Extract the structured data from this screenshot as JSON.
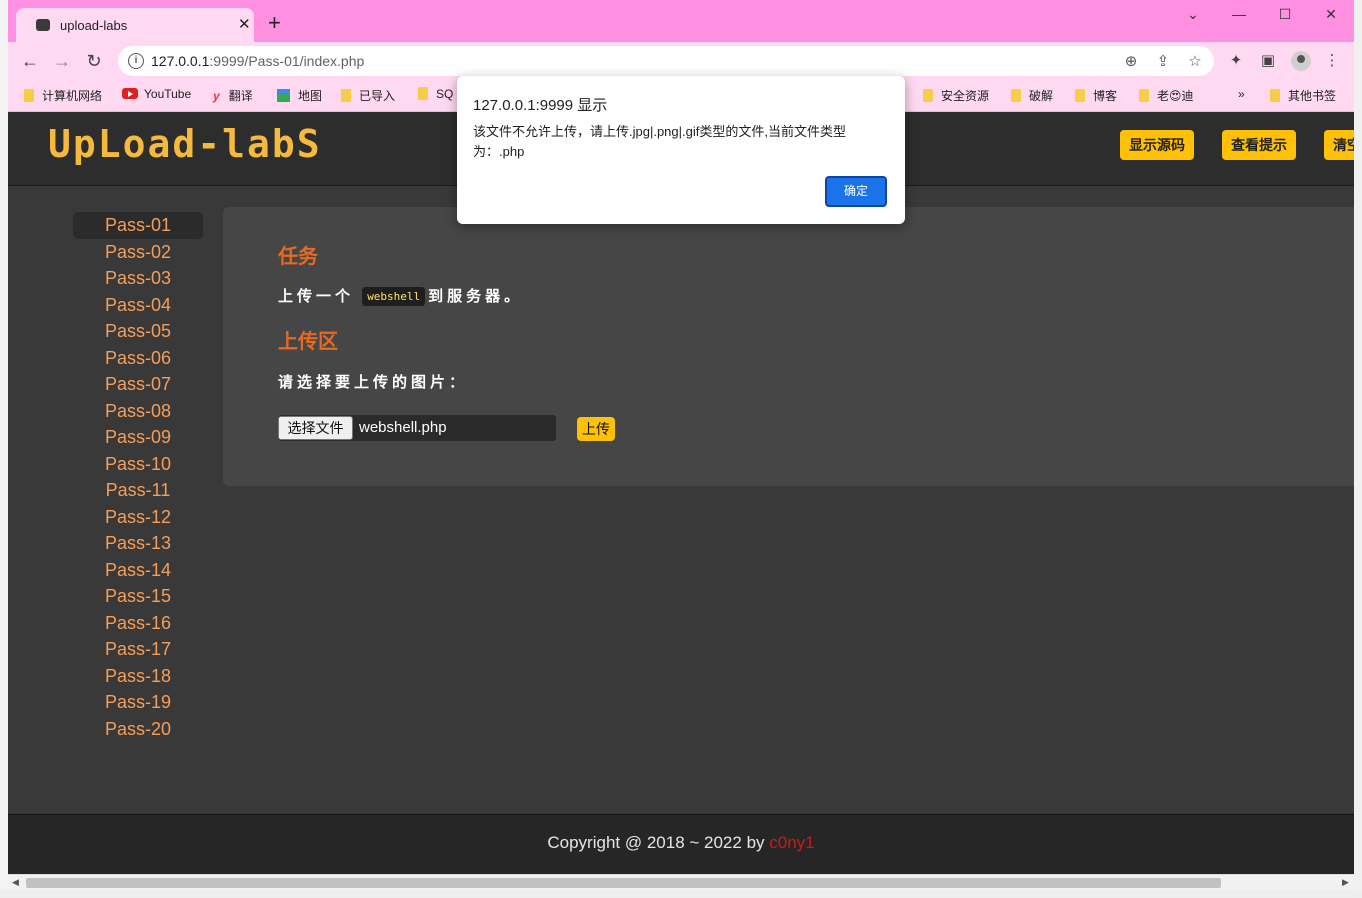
{
  "browser": {
    "tab_title": "upload-labs",
    "new_tab": "+",
    "url_host": "127.0.0.1",
    "url_rest": ":9999/Pass-01/index.php",
    "bookmarks": [
      "计算机网络",
      "YouTube",
      "翻译",
      "地图",
      "已导入",
      "SQ",
      "安全资源",
      "破解",
      "博客",
      "老😍迪",
      "»",
      "其他书签"
    ]
  },
  "header": {
    "logo": "UpLoad-labS",
    "buttons": [
      "显示源码",
      "查看提示",
      "清空"
    ]
  },
  "sidebar": {
    "items": [
      "Pass-01",
      "Pass-02",
      "Pass-03",
      "Pass-04",
      "Pass-05",
      "Pass-06",
      "Pass-07",
      "Pass-08",
      "Pass-09",
      "Pass-10",
      "Pass-11",
      "Pass-12",
      "Pass-13",
      "Pass-14",
      "Pass-15",
      "Pass-16",
      "Pass-17",
      "Pass-18",
      "Pass-19",
      "Pass-20"
    ],
    "active": "Pass-01"
  },
  "main": {
    "task_heading": "任务",
    "task_prefix": "上传一个",
    "task_code": "webshell",
    "task_suffix": "到服务器。",
    "upload_heading": "上传区",
    "upload_prompt": "请选择要上传的图片：",
    "file_button": "选择文件",
    "file_name": "webshell.php",
    "upload_button": "上传"
  },
  "footer": {
    "copyright": "Copyright @ 2018 ~ 2022 by ",
    "author": "c0ny1"
  },
  "dialog": {
    "title": "127.0.0.1:9999 显示",
    "message": "该文件不允许上传，请上传.jpg|.png|.gif类型的文件,当前文件类型为：.php",
    "ok_button": "确定"
  },
  "colors": {
    "tabstrip": "#ff8fe0",
    "toolbar": "#ffd9f2",
    "page_bg": "#393939",
    "accent_yellow": "#ffc107",
    "pass_link": "#f59e5a",
    "heading": "#e96921",
    "author": "#cc1a1a",
    "dialog_button": "#1a73e8"
  },
  "icons": {
    "tab": "favicon-icon",
    "close": "close-icon",
    "back": "back-arrow-icon",
    "forward": "forward-arrow-icon",
    "reload": "reload-icon",
    "info": "info-icon",
    "zoom": "zoom-icon",
    "share": "share-icon",
    "star": "star-icon",
    "extensions": "puzzle-icon",
    "sidepanel": "side-panel-icon",
    "menu": "kebab-menu-icon"
  }
}
